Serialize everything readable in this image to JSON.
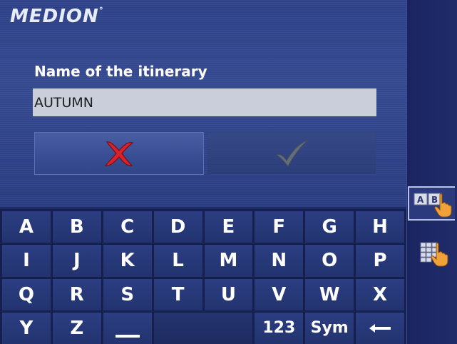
{
  "header": {
    "brand": "MEDION"
  },
  "form": {
    "prompt": "Name of the itinerary",
    "name_value": "AUTUMN"
  },
  "actions": {
    "cancel_icon": "x-icon",
    "confirm_icon": "check-icon"
  },
  "keyboard": {
    "rows": [
      [
        "A",
        "B",
        "C",
        "D",
        "E",
        "F",
        "G",
        "H"
      ],
      [
        "I",
        "J",
        "K",
        "L",
        "M",
        "N",
        "O",
        "P"
      ],
      [
        "Q",
        "R",
        "S",
        "T",
        "U",
        "V",
        "W",
        "X"
      ],
      [
        "Y",
        "Z",
        "",
        "",
        "123",
        "Sym",
        ""
      ]
    ],
    "backspace_icon": "backspace-arrow-icon"
  },
  "sidebar": {
    "buttons": [
      {
        "name": "mode-abc",
        "icon": "ab-hand-icon",
        "selected": true
      },
      {
        "name": "mode-grid",
        "icon": "grid-hand-icon",
        "selected": false
      }
    ]
  },
  "colors": {
    "background": "#1c2868",
    "key": "#2c3e82",
    "input_bg": "#c9ceda",
    "cancel_red": "#d8232a"
  }
}
